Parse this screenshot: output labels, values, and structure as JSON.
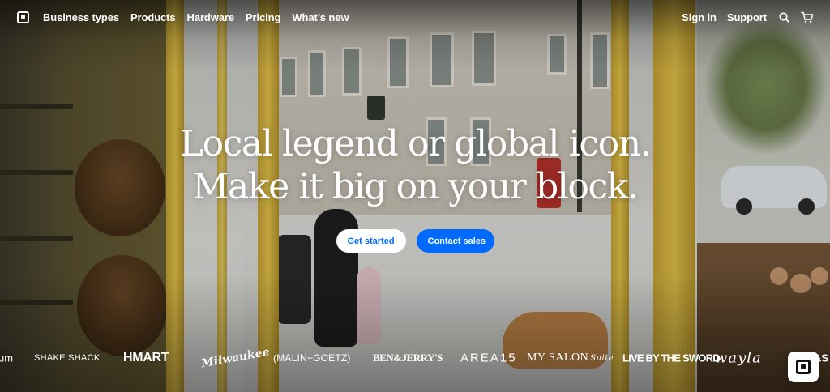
{
  "nav": {
    "logo_icon": "square-logo-icon",
    "links": [
      {
        "label": "Business types"
      },
      {
        "label": "Products"
      },
      {
        "label": "Hardware"
      },
      {
        "label": "Pricing"
      },
      {
        "label": "What’s new"
      }
    ],
    "sign_in": "Sign in",
    "support": "Support",
    "search_icon": "search-icon",
    "cart_icon": "cart-icon"
  },
  "hero": {
    "headline_line1": "Local legend or global icon.",
    "headline_line2": "Make it big on your block.",
    "cta_primary": "Get started",
    "cta_secondary": "Contact sales"
  },
  "brands": {
    "items": [
      {
        "label": "um"
      },
      {
        "label": "SHAKE SHACK"
      },
      {
        "label": "HMART"
      },
      {
        "label": "Milwaukee"
      },
      {
        "label": "(MALIN+GOETZ)"
      },
      {
        "label": "BEN&JERRY'S"
      },
      {
        "label": "AREA15"
      },
      {
        "label": "MY SALON",
        "sub": "Suite"
      },
      {
        "label": "LIVE BY THE SWORD"
      },
      {
        "label": "wayla"
      },
      {
        "label": "&S"
      }
    ]
  },
  "colors": {
    "accent": "#006aff",
    "text_on_hero": "#ffffff"
  },
  "chat_button_icon": "square-logo-icon"
}
